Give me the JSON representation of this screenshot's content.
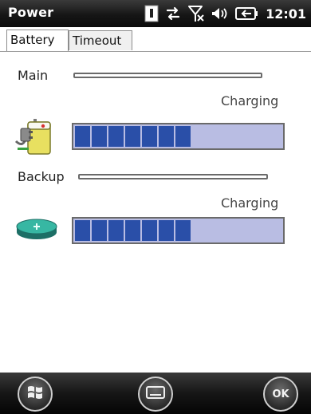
{
  "status_bar": {
    "app_title": "Power",
    "clock": "12:01",
    "icons": [
      "notification-icon",
      "data-connection-icon",
      "no-signal-icon",
      "volume-icon",
      "battery-icon"
    ]
  },
  "tabs": [
    {
      "label": "Battery",
      "selected": true
    },
    {
      "label": "Timeout",
      "selected": false
    }
  ],
  "main_battery": {
    "label": "Main",
    "status": "Charging",
    "icon": "main-battery-charging-icon",
    "level_percent": 62
  },
  "backup_battery": {
    "label": "Backup",
    "status": "Charging",
    "icon": "backup-battery-icon",
    "level_percent": 62
  },
  "soft_keys": {
    "start": "windows-start-icon",
    "keyboard": "keyboard-icon",
    "ok_label": "OK"
  },
  "colors": {
    "bar_fill": "#2a4fa8",
    "bar_background": "#b9bde3",
    "status_bar": "#161616"
  }
}
